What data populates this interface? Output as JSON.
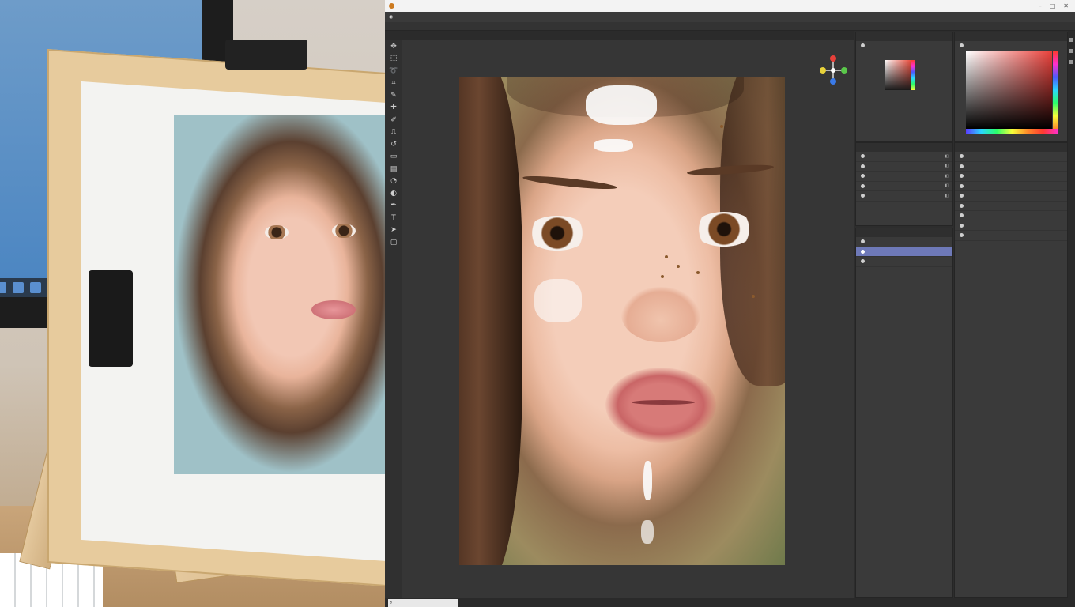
{
  "titlebar": {
    "title": "",
    "controls": [
      "–",
      "□",
      "✕"
    ]
  },
  "menubar": {
    "items": [
      "",
      "",
      "",
      "",
      "",
      "",
      "",
      "",
      "",
      "",
      "",
      "",
      ""
    ]
  },
  "optionsbar": {
    "items": [
      "",
      "",
      "",
      "",
      "",
      "",
      "",
      "",
      "",
      "",
      "",
      "",
      "",
      ""
    ]
  },
  "docbar": {
    "items": [
      "",
      "",
      "",
      ""
    ]
  },
  "tools": [
    "move-icon",
    "marquee-icon",
    "lasso-icon",
    "crop-icon",
    "eyedropper-icon",
    "heal-icon",
    "brush-icon",
    "stamp-icon",
    "history-brush-icon",
    "eraser-icon",
    "gradient-icon",
    "blur-icon",
    "dodge-icon",
    "pen-icon",
    "type-icon",
    "path-select-icon",
    "shape-icon"
  ],
  "mini_color_panel": {
    "tab_label": "",
    "header": ""
  },
  "color_panel": {
    "tab_label": "",
    "header": ""
  },
  "adjust_panel": {
    "tab_label": "",
    "rows": [
      "",
      "",
      "",
      "",
      ""
    ]
  },
  "layers_panel": {
    "tab_label": "",
    "selected_index": 1,
    "rows": [
      "",
      "",
      ""
    ]
  },
  "props_panel": {
    "tab_label": "",
    "rows": [
      "",
      "",
      "",
      "",
      "",
      "",
      "",
      "",
      ""
    ]
  },
  "statusbar": {
    "zoom": "",
    "items": [
      "",
      "",
      "",
      ""
    ]
  },
  "colors": {
    "accent": "#6e79b8",
    "titlebar": "#f3f3f3",
    "panel": "#3a3a3a",
    "canvas_bg": "#363636"
  }
}
